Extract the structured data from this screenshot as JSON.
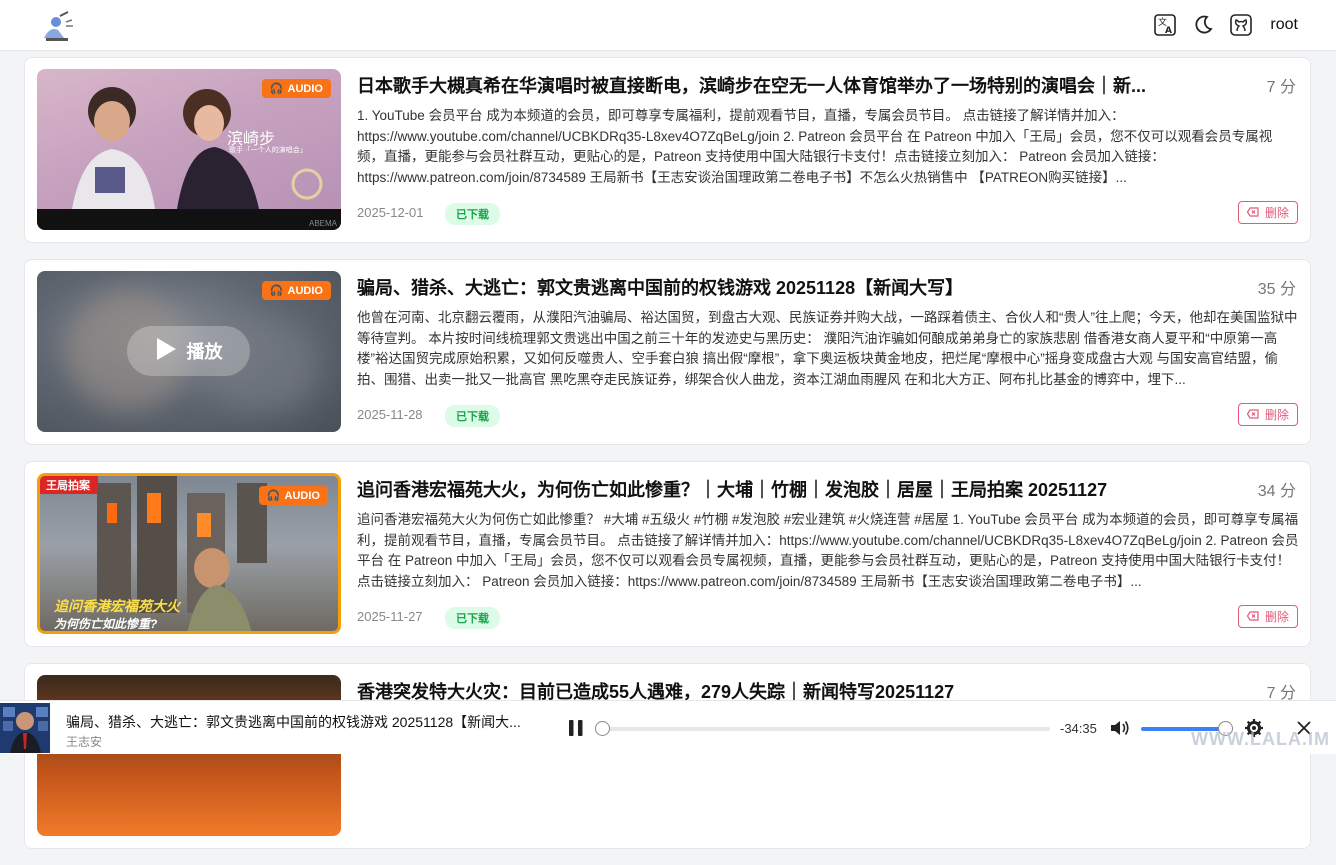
{
  "header": {
    "user": "root"
  },
  "items": [
    {
      "title": "日本歌手大槻真希在华演唱时被直接断电，滨崎步在空无一人体育馆举办了一场特别的演唱会｜新...",
      "duration": "7 分",
      "description": "1. YouTube 会员平台 成为本频道的会员，即可尊享专属福利，提前观看节目，直播，专属会员节目。 点击链接了解详情并加入：https://www.youtube.com/channel/UCBKDRq35-L8xev4O7ZqBeLg/join 2. Patreon 会员平台 在 Patreon 中加入「王局」会员，您不仅可以观看会员专属视频，直播，更能参与会员社群互动，更贴心的是，Patreon 支持使用中国大陆银行卡支付！点击链接立刻加入： Patreon 会员加入链接：https://www.patreon.com/join/8734589 王局新书【王志安谈治国理政第二卷电子书】不怎么火热销售中 【PATREON购买链接】...",
      "date": "2025-12-01",
      "status": "已下载",
      "badge": "AUDIO",
      "delete": "删除",
      "thumb_caption": "滨崎步",
      "thumb_sub": "歌手 ·「一个人的演唱会」",
      "thumb_mark": "ABEMA"
    },
    {
      "title": "骗局、猎杀、大逃亡：郭文贵逃离中国前的权钱游戏 20251128【新闻大写】",
      "duration": "35 分",
      "description": "他曾在河南、北京翻云覆雨，从濮阳汽油骗局、裕达国贸，到盘古大观、民族证券并购大战，一路踩着债主、合伙人和“贵人”往上爬；今天，他却在美国监狱中等待宣判。 本片按时间线梳理郭文贵逃出中国之前三十年的发迹史与黑历史： 濮阳汽油诈骗如何酿成弟弟身亡的家族悲剧 借香港女商人夏平和“中原第一高楼”裕达国贸完成原始积累，又如何反噬贵人、空手套白狼 搞出假“摩根”，拿下奥运板块黄金地皮，把烂尾“摩根中心”摇身变成盘古大观 与国安高官结盟，偷拍、围猎、出卖一批又一批高官 黑吃黑夺走民族证券，绑架合伙人曲龙，资本江湖血雨腥风 在和北大方正、阿布扎比基金的博弈中，埋下...",
      "date": "2025-11-28",
      "status": "已下载",
      "badge": "AUDIO",
      "delete": "删除",
      "play": "播放"
    },
    {
      "title": "追问香港宏福苑大火，为何伤亡如此惨重？｜大埔｜竹棚｜发泡胶｜居屋｜王局拍案 20251127",
      "duration": "34 分",
      "description": "追问香港宏福苑大火为何伤亡如此惨重？ #大埔 #五级火 #竹棚 #发泡胶 #宏业建筑 #火烧连营 #居屋 1. YouTube 会员平台 成为本频道的会员，即可尊享专属福利，提前观看节目，直播，专属会员节目。 点击链接了解详情并加入：https://www.youtube.com/channel/UCBKDRq35-L8xev4O7ZqBeLg/join 2. Patreon 会员平台 在 Patreon 中加入「王局」会员，您不仅可以观看会员专属视频，直播，更能参与会员社群互动，更贴心的是，Patreon 支持使用中国大陆银行卡支付！点击链接立刻加入： Patreon 会员加入链接：https://www.patreon.com/join/8734589 王局新书【王志安谈治国理政第二卷电子书】...",
      "date": "2025-11-27",
      "status": "已下载",
      "badge": "AUDIO",
      "delete": "删除",
      "thumb_tag": "王局拍案",
      "thumb_caption": "追问香港宏福苑大火",
      "thumb_sub": "为何伤亡如此惨重?"
    },
    {
      "title": "香港突发特大火灾：目前已造成55人遇难，279人失踪｜新闻特写20251127",
      "duration": "7 分"
    }
  ],
  "player": {
    "title": "骗局、猎杀、大逃亡：郭文贵逃离中国前的权钱游戏 20251128【新闻大...",
    "artist": "王志安",
    "time": "-34:35",
    "progress": 0.0,
    "volume": 0.95
  },
  "watermark": "WWW.LALA.IM"
}
